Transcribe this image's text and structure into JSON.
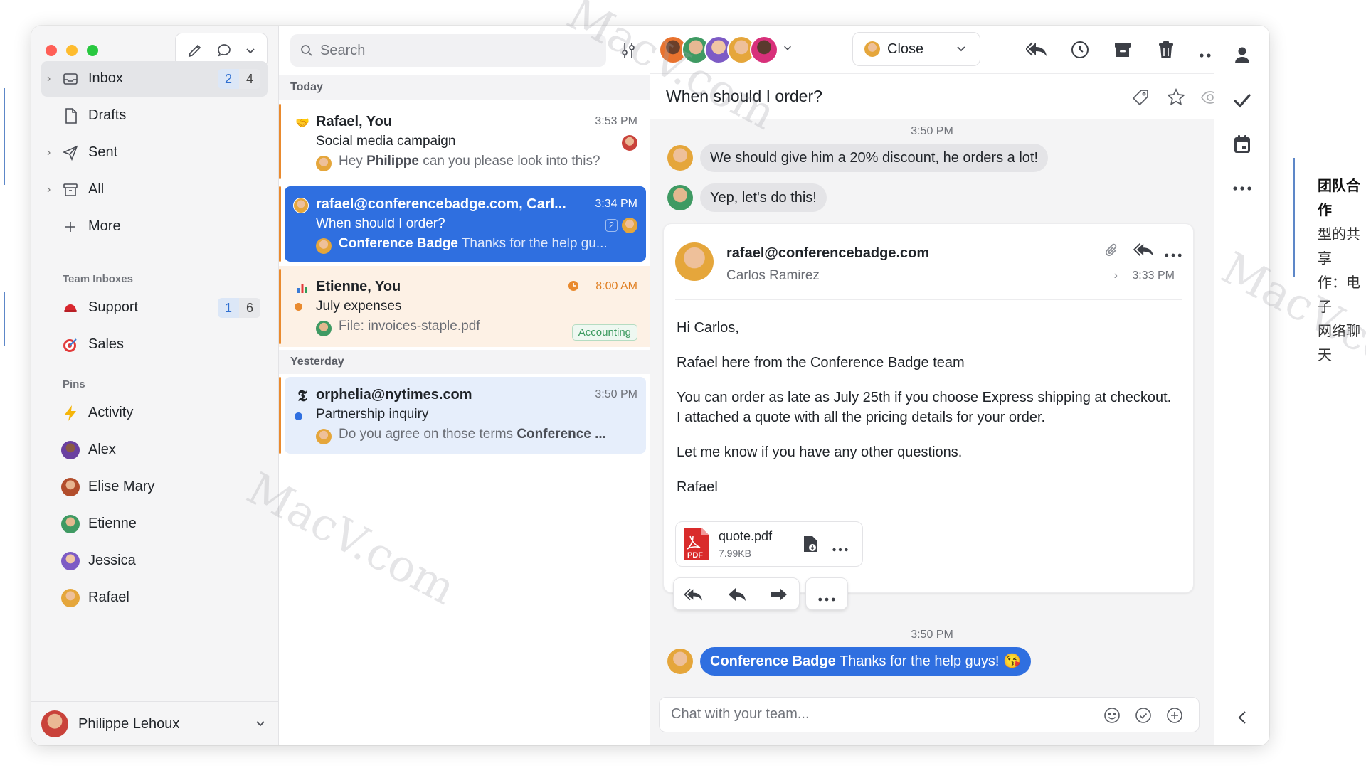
{
  "sidebar": {
    "nav": [
      {
        "label": "Inbox",
        "count_unread": "2",
        "count_total": "4"
      },
      {
        "label": "Drafts"
      },
      {
        "label": "Sent"
      },
      {
        "label": "All"
      },
      {
        "label": "More"
      }
    ],
    "team_inboxes_title": "Team Inboxes",
    "team_inboxes": [
      {
        "label": "Support",
        "count_unread": "1",
        "count_total": "6"
      },
      {
        "label": "Sales"
      }
    ],
    "pins_title": "Pins",
    "pins": [
      {
        "label": "Activity"
      },
      {
        "label": "Alex"
      },
      {
        "label": "Elise Mary"
      },
      {
        "label": "Etienne"
      },
      {
        "label": "Jessica"
      },
      {
        "label": "Rafael"
      }
    ],
    "user_name": "Philippe Lehoux"
  },
  "list": {
    "search_placeholder": "Search",
    "group_today": "Today",
    "group_yesterday": "Yesterday",
    "messages": [
      {
        "from": "Rafael, You",
        "time": "3:53 PM",
        "subject": "Social media campaign",
        "preview_prefix": "Hey ",
        "preview_bold": "Philippe",
        "preview_rest": " can you please look into this?"
      },
      {
        "from": "rafael@conferencebadge.com, Carl...",
        "time": "3:34 PM",
        "subject": "When should I order?",
        "badge": "2",
        "preview_bold": "Conference Badge",
        "preview_rest": " Thanks for the help gu..."
      },
      {
        "from": "Etienne, You",
        "time": "8:00 AM",
        "subject": "July expenses",
        "preview_rest": "File: invoices-staple.pdf",
        "tag": "Accounting"
      },
      {
        "from": "orphelia@nytimes.com",
        "time": "3:50 PM",
        "subject": "Partnership inquiry",
        "preview_rest": "Do you agree on those terms ",
        "preview_bold": "Conference ..."
      }
    ]
  },
  "conversation": {
    "close_label": "Close",
    "subject": "When should I order?",
    "stamp1": "3:50 PM",
    "chat1": "We should give him a 20% discount, he orders a lot!",
    "chat2": "Yep, let's do this!",
    "email": {
      "from_address": "rafael@conferencebadge.com",
      "from_name": "Carlos Ramirez",
      "time": "3:33 PM",
      "body": [
        "Hi Carlos,",
        "Rafael here from the Conference Badge team",
        "You can order as late as July 25th if you choose Express shipping at checkout. I attached a quote with all the pricing details for your order.",
        "Let me know if you have any other questions.",
        "Rafael"
      ],
      "attachment_name": "quote.pdf",
      "attachment_size": "7.99KB",
      "attachment_type": "PDF"
    },
    "stamp2": "3:50 PM",
    "chat3_bold": "Conference Badge",
    "chat3_rest": " Thanks for the help guys! 😘",
    "chat_placeholder": "Chat with your team..."
  },
  "side_text": [
    "团队合作",
    "型的共享",
    "作：电子",
    "网络聊天"
  ],
  "watermark": "MacV.com",
  "colors": {
    "accent": "#2f6fe0",
    "unread_dot": "#e98a2e",
    "traffic_red": "#ff5f57",
    "traffic_yellow": "#febc2e",
    "traffic_green": "#28c840"
  }
}
